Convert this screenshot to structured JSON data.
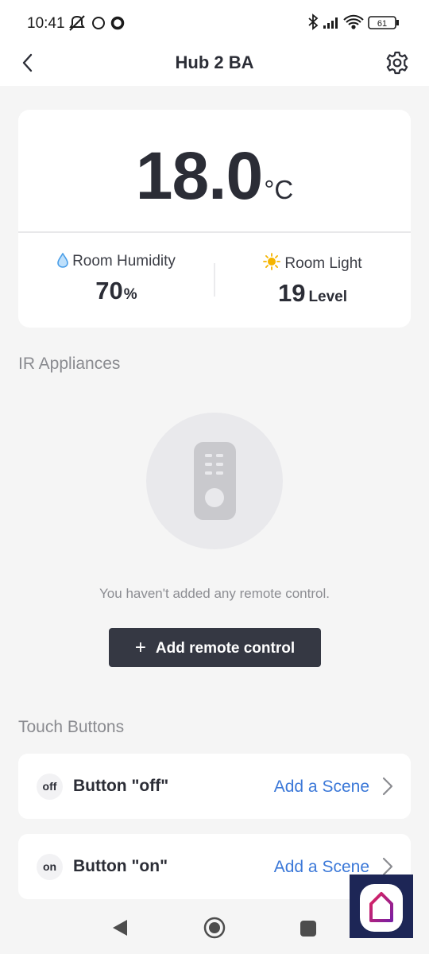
{
  "status_bar": {
    "time": "10:41",
    "battery": "61"
  },
  "header": {
    "title": "Hub 2 BA",
    "back_icon": "chevron-left-icon",
    "settings_icon": "gear-icon"
  },
  "climate": {
    "temperature": "18.0",
    "temperature_unit": "°C",
    "humidity": {
      "label": "Room Humidity",
      "value": "70",
      "unit": "%",
      "icon": "water-drop-icon",
      "icon_color": "#4a9ee8"
    },
    "light": {
      "label": "Room Light",
      "value": "19",
      "unit": "Level",
      "icon": "sun-icon",
      "icon_color": "#f5b400"
    }
  },
  "ir_appliances": {
    "heading": "IR Appliances",
    "empty_icon": "remote-control-icon",
    "empty_text": "You haven't added any remote control.",
    "add_button_label": "Add remote control",
    "add_button_icon": "+"
  },
  "touch_buttons": {
    "heading": "Touch Buttons",
    "items": [
      {
        "badge": "off",
        "name": "Button \"off\"",
        "action": "Add a Scene"
      },
      {
        "badge": "on",
        "name": "Button \"on\"",
        "action": "Add a Scene"
      }
    ]
  },
  "colors": {
    "accent_link": "#3b78d8",
    "primary_button": "#353843",
    "background": "#f5f5f5"
  }
}
